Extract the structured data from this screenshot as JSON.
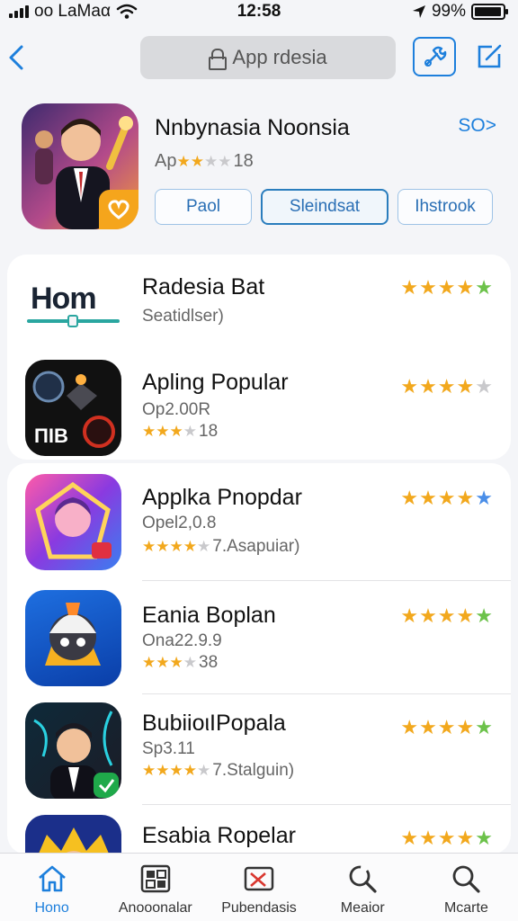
{
  "status_bar": {
    "carrier": "oo LaMaα",
    "time": "12:58",
    "battery": "99%",
    "battery_level": 0.95
  },
  "nav": {
    "search_text": "App rdesia"
  },
  "header": {
    "title": "Nnbynasia Noonsia",
    "link": "SO>",
    "subtitle_prefix": "Ap",
    "subtitle_suffix": "18",
    "rating": 2,
    "pills": [
      "Paol",
      "Sleindsat",
      "Ihstrook"
    ],
    "selected_pill": 1
  },
  "items": [
    {
      "title": "Radesia Bat",
      "subtitle": "Seatidlser)",
      "rating_extra": "",
      "rating": 5,
      "last_star": "green"
    },
    {
      "title": "Apling Popular",
      "subtitle": "Op2.00R",
      "rating_extra": "18",
      "inline_rating": 3,
      "rating": 3.5,
      "last_star": "off"
    },
    {
      "title": "Applka Pnopdar",
      "subtitle": "Opel2,0.8",
      "rating_extra": "7.Asapuiar)",
      "inline_rating": 4,
      "rating": 5,
      "last_star": "blue"
    },
    {
      "title": "Eania Boplan",
      "subtitle": "Ona22.9.9",
      "rating_extra": "38",
      "inline_rating": 3,
      "rating": 5,
      "last_star": "green"
    },
    {
      "title": "BubiioιIPopala",
      "subtitle": "Sp3.11",
      "rating_extra": "7.Stalguin)",
      "inline_rating": 4,
      "rating": 4.5,
      "last_star": "green"
    },
    {
      "title": "Esabia Ropelar",
      "subtitle": "",
      "rating_extra": "",
      "rating": 5,
      "last_star": "green"
    }
  ],
  "icons": {
    "item0": "hom-logo",
    "item1": "dark-game",
    "item2": "avatar-purple",
    "item3": "robot-blue",
    "item4": "person-dark",
    "item5": "crown-blue"
  },
  "tabs": [
    {
      "label": "Hono",
      "icon": "home-icon"
    },
    {
      "label": "Anooonalar",
      "icon": "apps-icon"
    },
    {
      "label": "Pubendasis",
      "icon": "mail-icon"
    },
    {
      "label": "Meaior",
      "icon": "search-refresh-icon"
    },
    {
      "label": "Mcarte",
      "icon": "search-icon"
    }
  ],
  "colors": {
    "accent": "#1d7fdc",
    "star": "#f2a81d",
    "green": "#6cc24a"
  }
}
